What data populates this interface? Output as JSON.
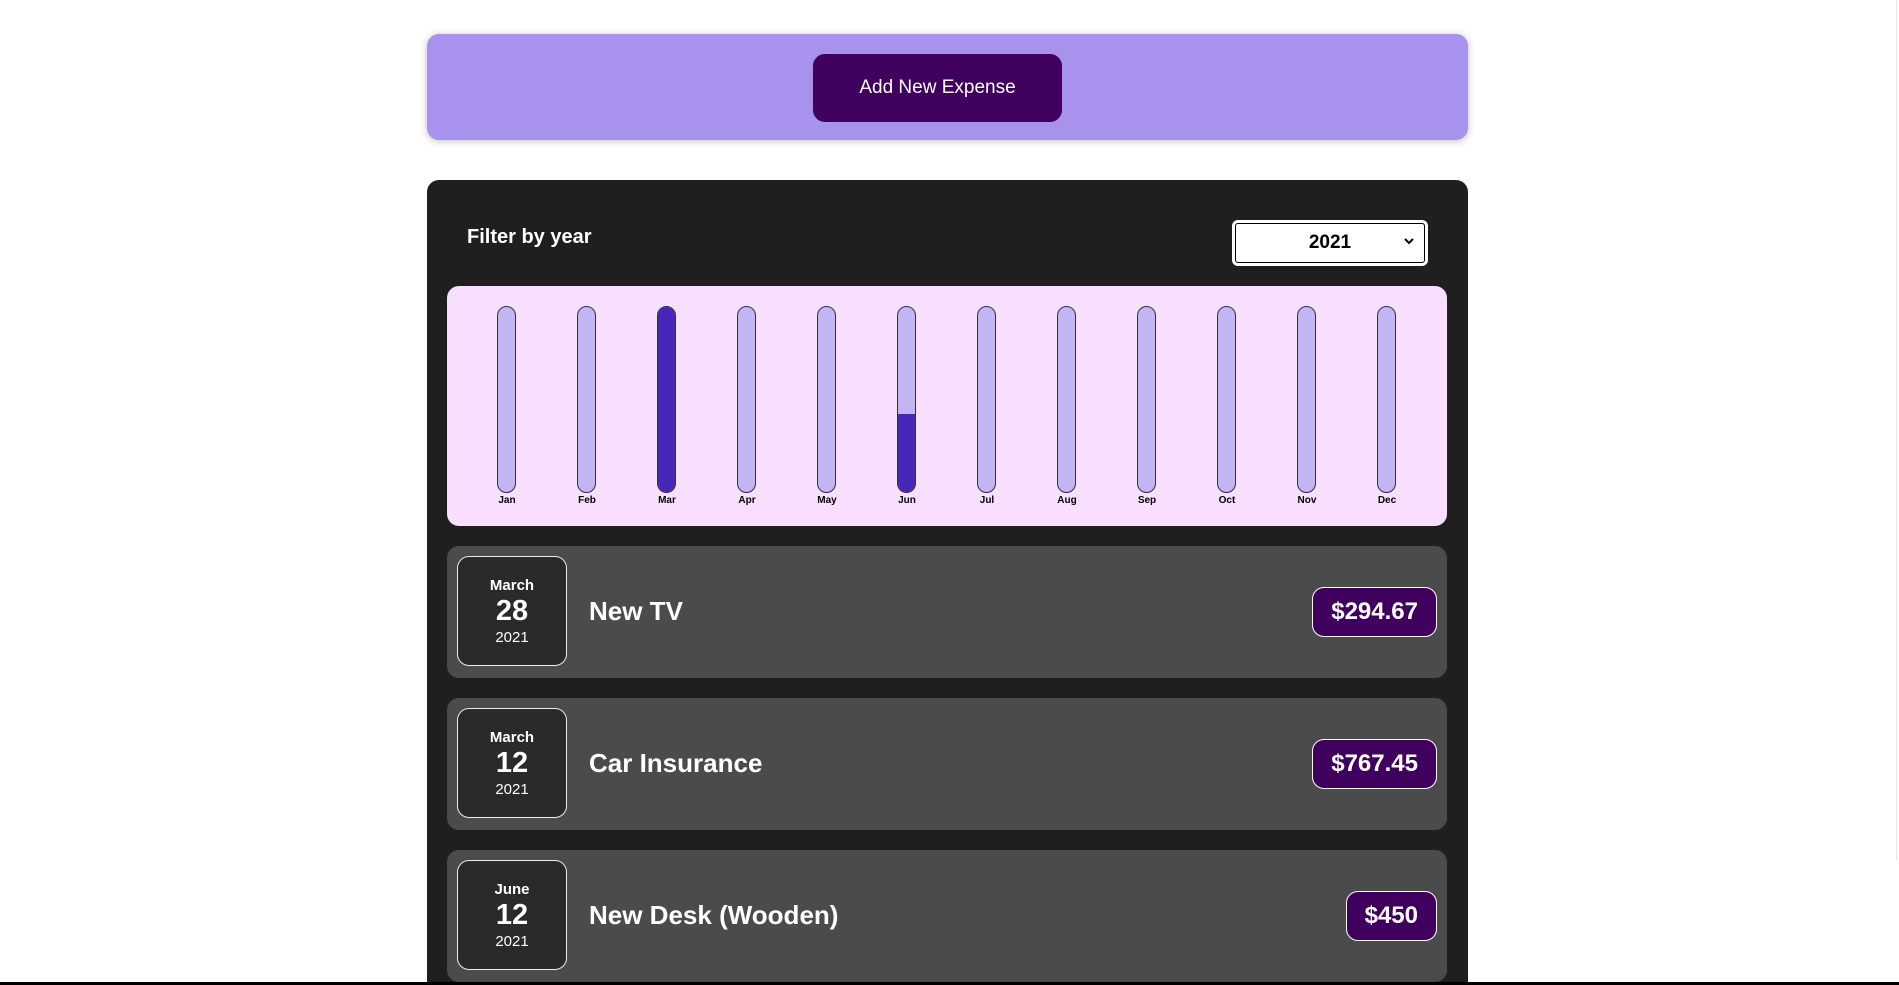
{
  "new_expense": {
    "button_label": "Add New Expense"
  },
  "filter": {
    "label": "Filter by year",
    "selected_year": "2021"
  },
  "chart_data": {
    "type": "bar",
    "categories": [
      "Jan",
      "Feb",
      "Mar",
      "Apr",
      "May",
      "Jun",
      "Jul",
      "Aug",
      "Sep",
      "Oct",
      "Nov",
      "Dec"
    ],
    "values": [
      0,
      0,
      1062.12,
      0,
      0,
      450,
      0,
      0,
      0,
      0,
      0,
      0
    ],
    "ylim": [
      0,
      1062.12
    ],
    "title": "",
    "xlabel": "",
    "ylabel": ""
  },
  "expenses": [
    {
      "month": "March",
      "day": "28",
      "year": "2021",
      "title": "New TV",
      "amount": "$294.67"
    },
    {
      "month": "March",
      "day": "12",
      "year": "2021",
      "title": "Car Insurance",
      "amount": "$767.45"
    },
    {
      "month": "June",
      "day": "12",
      "year": "2021",
      "title": "New Desk (Wooden)",
      "amount": "$450"
    }
  ],
  "colors": {
    "accent": "#40005d",
    "new_expense_bg": "#a892ee",
    "panel_bg": "#1f1f1f",
    "chart_bg": "#f8dfff",
    "bar_empty": "#c3b4f3",
    "bar_fill": "#4826b9",
    "item_bg": "#4b4b4b"
  },
  "icons": {
    "select_chevron": "chevron-down-icon"
  }
}
